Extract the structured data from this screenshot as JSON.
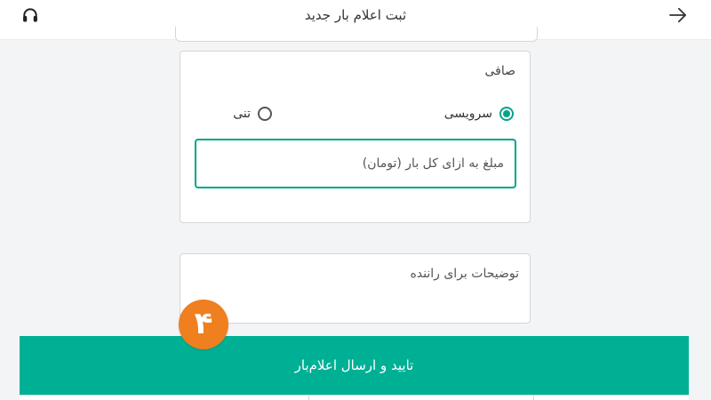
{
  "header": {
    "title": "ثبت اعلام بار جدید",
    "back_icon": "arrow-right-icon",
    "support_icon": "headset-icon"
  },
  "fare_panel": {
    "label": "صافی",
    "options": [
      {
        "label": "سرویسی",
        "selected": true
      },
      {
        "label": "تنی",
        "selected": false
      }
    ],
    "amount_placeholder": "مبلغ به ازای کل بار (تومان)",
    "amount_value": ""
  },
  "notes": {
    "placeholder": "توضیحات برای راننده",
    "value": ""
  },
  "step_badge": "۴",
  "submit_label": "تایید و ارسال اعلام‌بار",
  "colors": {
    "accent": "#00a58a",
    "button": "#00b095",
    "badge": "#f07f1f"
  }
}
